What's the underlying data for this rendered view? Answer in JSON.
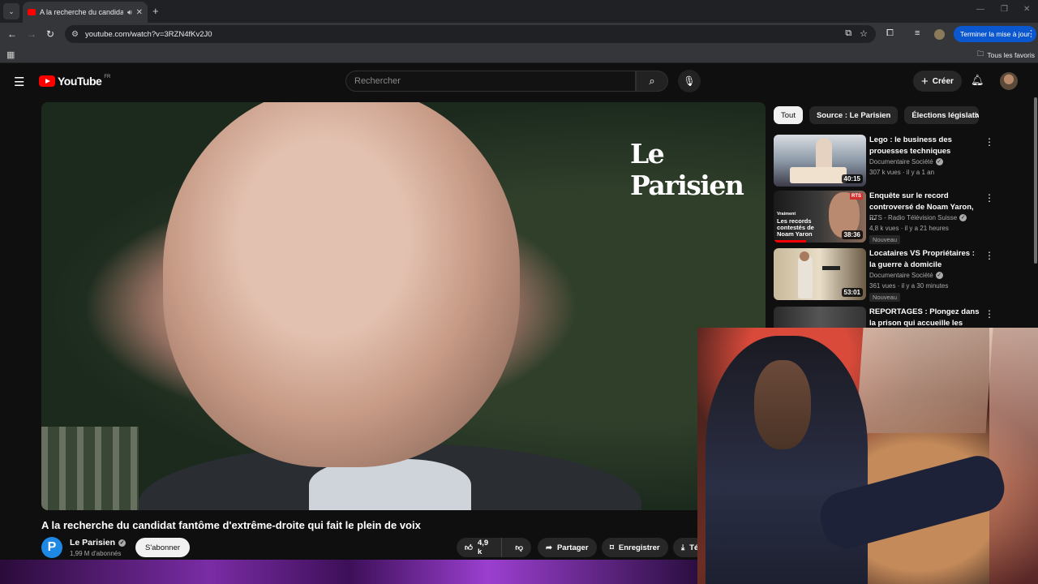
{
  "browser": {
    "tab_title": "A la recherche du candidat",
    "url": "youtube.com/watch?v=3RZN4fKv2J0",
    "update_button": "Terminer la mise à jour",
    "all_bookmarks": "Tous les favoris"
  },
  "header": {
    "logo_text": "YouTube",
    "region": "FR",
    "search_placeholder": "Rechercher",
    "create_label": "Créer"
  },
  "video": {
    "brand_overlay": "Le Parisien",
    "title": "A la recherche du candidat fantôme d'extrême-droite qui fait le plein de voix"
  },
  "channel": {
    "avatar_letter": "P",
    "name": "Le Parisien",
    "subscribers": "1,99 M d'abonnés",
    "subscribe_label": "S'abonner"
  },
  "actions": {
    "likes": "4,9 k",
    "share": "Partager",
    "save": "Enregistrer",
    "download_partial": "Té"
  },
  "chips": [
    "Tout",
    "Source : Le Parisien",
    "Élections législatives"
  ],
  "recommendations": [
    {
      "title": "Lego : le business des prouesses techniques",
      "channel": "Documentaire Société",
      "meta": "307 k vues · il y a 1 an",
      "duration": "40:15",
      "badge": ""
    },
    {
      "title": "Enquête sur le record controversé de Noam Yaron, ...",
      "channel": "RTS - Radio Télévision Suisse",
      "meta": "4,8 k vues · il y a 21 heures",
      "duration": "38:36",
      "badge": "Nouveau",
      "thumb_text_top": "Vraiment",
      "thumb_text": "Les records contestés de Noam Yaron",
      "thumb_logo": "RTS"
    },
    {
      "title": "Locataires VS Propriétaires : la guerre à domicile",
      "channel": "Documentaire Société",
      "meta": "361 vues · il y a 30 minutes",
      "duration": "53:01",
      "badge": "Nouveau"
    },
    {
      "title": "REPORTAGES : Plongez dans la prison qui accueille les détenu...",
      "channel": "",
      "meta": "",
      "duration": "",
      "badge": ""
    }
  ],
  "colors": {
    "accent": "#ff0000",
    "background": "#0f0f0f",
    "update_button": "#0b57d0",
    "channel_avatar": "#1e88e5"
  }
}
